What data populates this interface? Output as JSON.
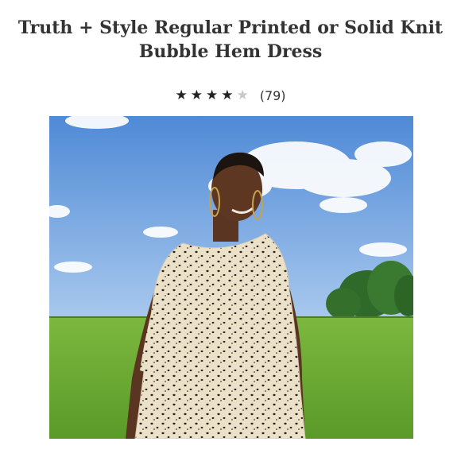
{
  "product": {
    "title_line1": "Truth + Style Regular Printed or Solid Knit",
    "title_line2": "Bubble Hem Dress"
  },
  "rating": {
    "stars_filled": 4,
    "stars_total": 5,
    "star_glyph": "★",
    "review_count_text": "(79)"
  },
  "colors": {
    "text": "#333333",
    "star_filled": "#222222",
    "star_empty": "#c9c9c9",
    "sky": "#6fa3e0",
    "grass": "#6aa533",
    "dress": "#ebe0c8"
  },
  "image": {
    "subject": "model-in-spotted-dress-on-grass-field"
  }
}
